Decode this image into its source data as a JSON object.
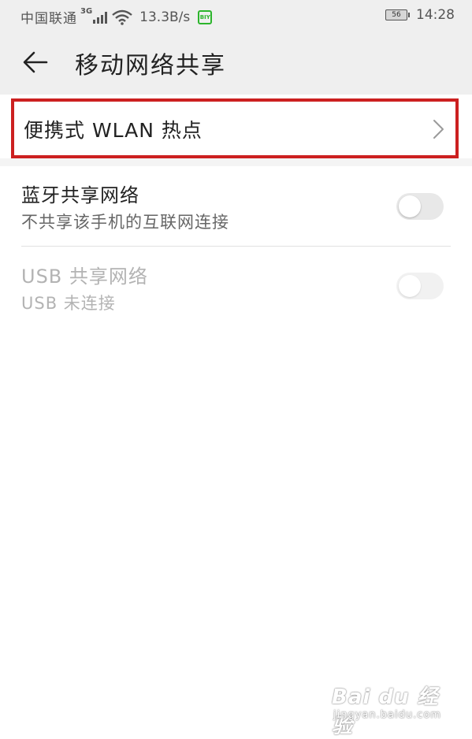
{
  "status_bar": {
    "carrier": "中国联通",
    "network_type": "3G",
    "speed": "13.3B/s",
    "app_badge": "BIY",
    "battery": "56",
    "time": "14:28"
  },
  "header": {
    "title": "移动网络共享"
  },
  "items": [
    {
      "title": "便携式 WLAN 热点"
    },
    {
      "title": "蓝牙共享网络",
      "subtitle": "不共享该手机的互联网连接",
      "enabled": false
    },
    {
      "title": "USB 共享网络",
      "subtitle": "USB 未连接",
      "enabled": false,
      "disabled": true
    }
  ],
  "watermark": {
    "brand": "Bai du 经验",
    "url": "jingyan.baidu.com"
  },
  "colors": {
    "highlight_border": "#cc2020",
    "header_bg": "#efefef",
    "app_badge": "#2cb52c"
  }
}
